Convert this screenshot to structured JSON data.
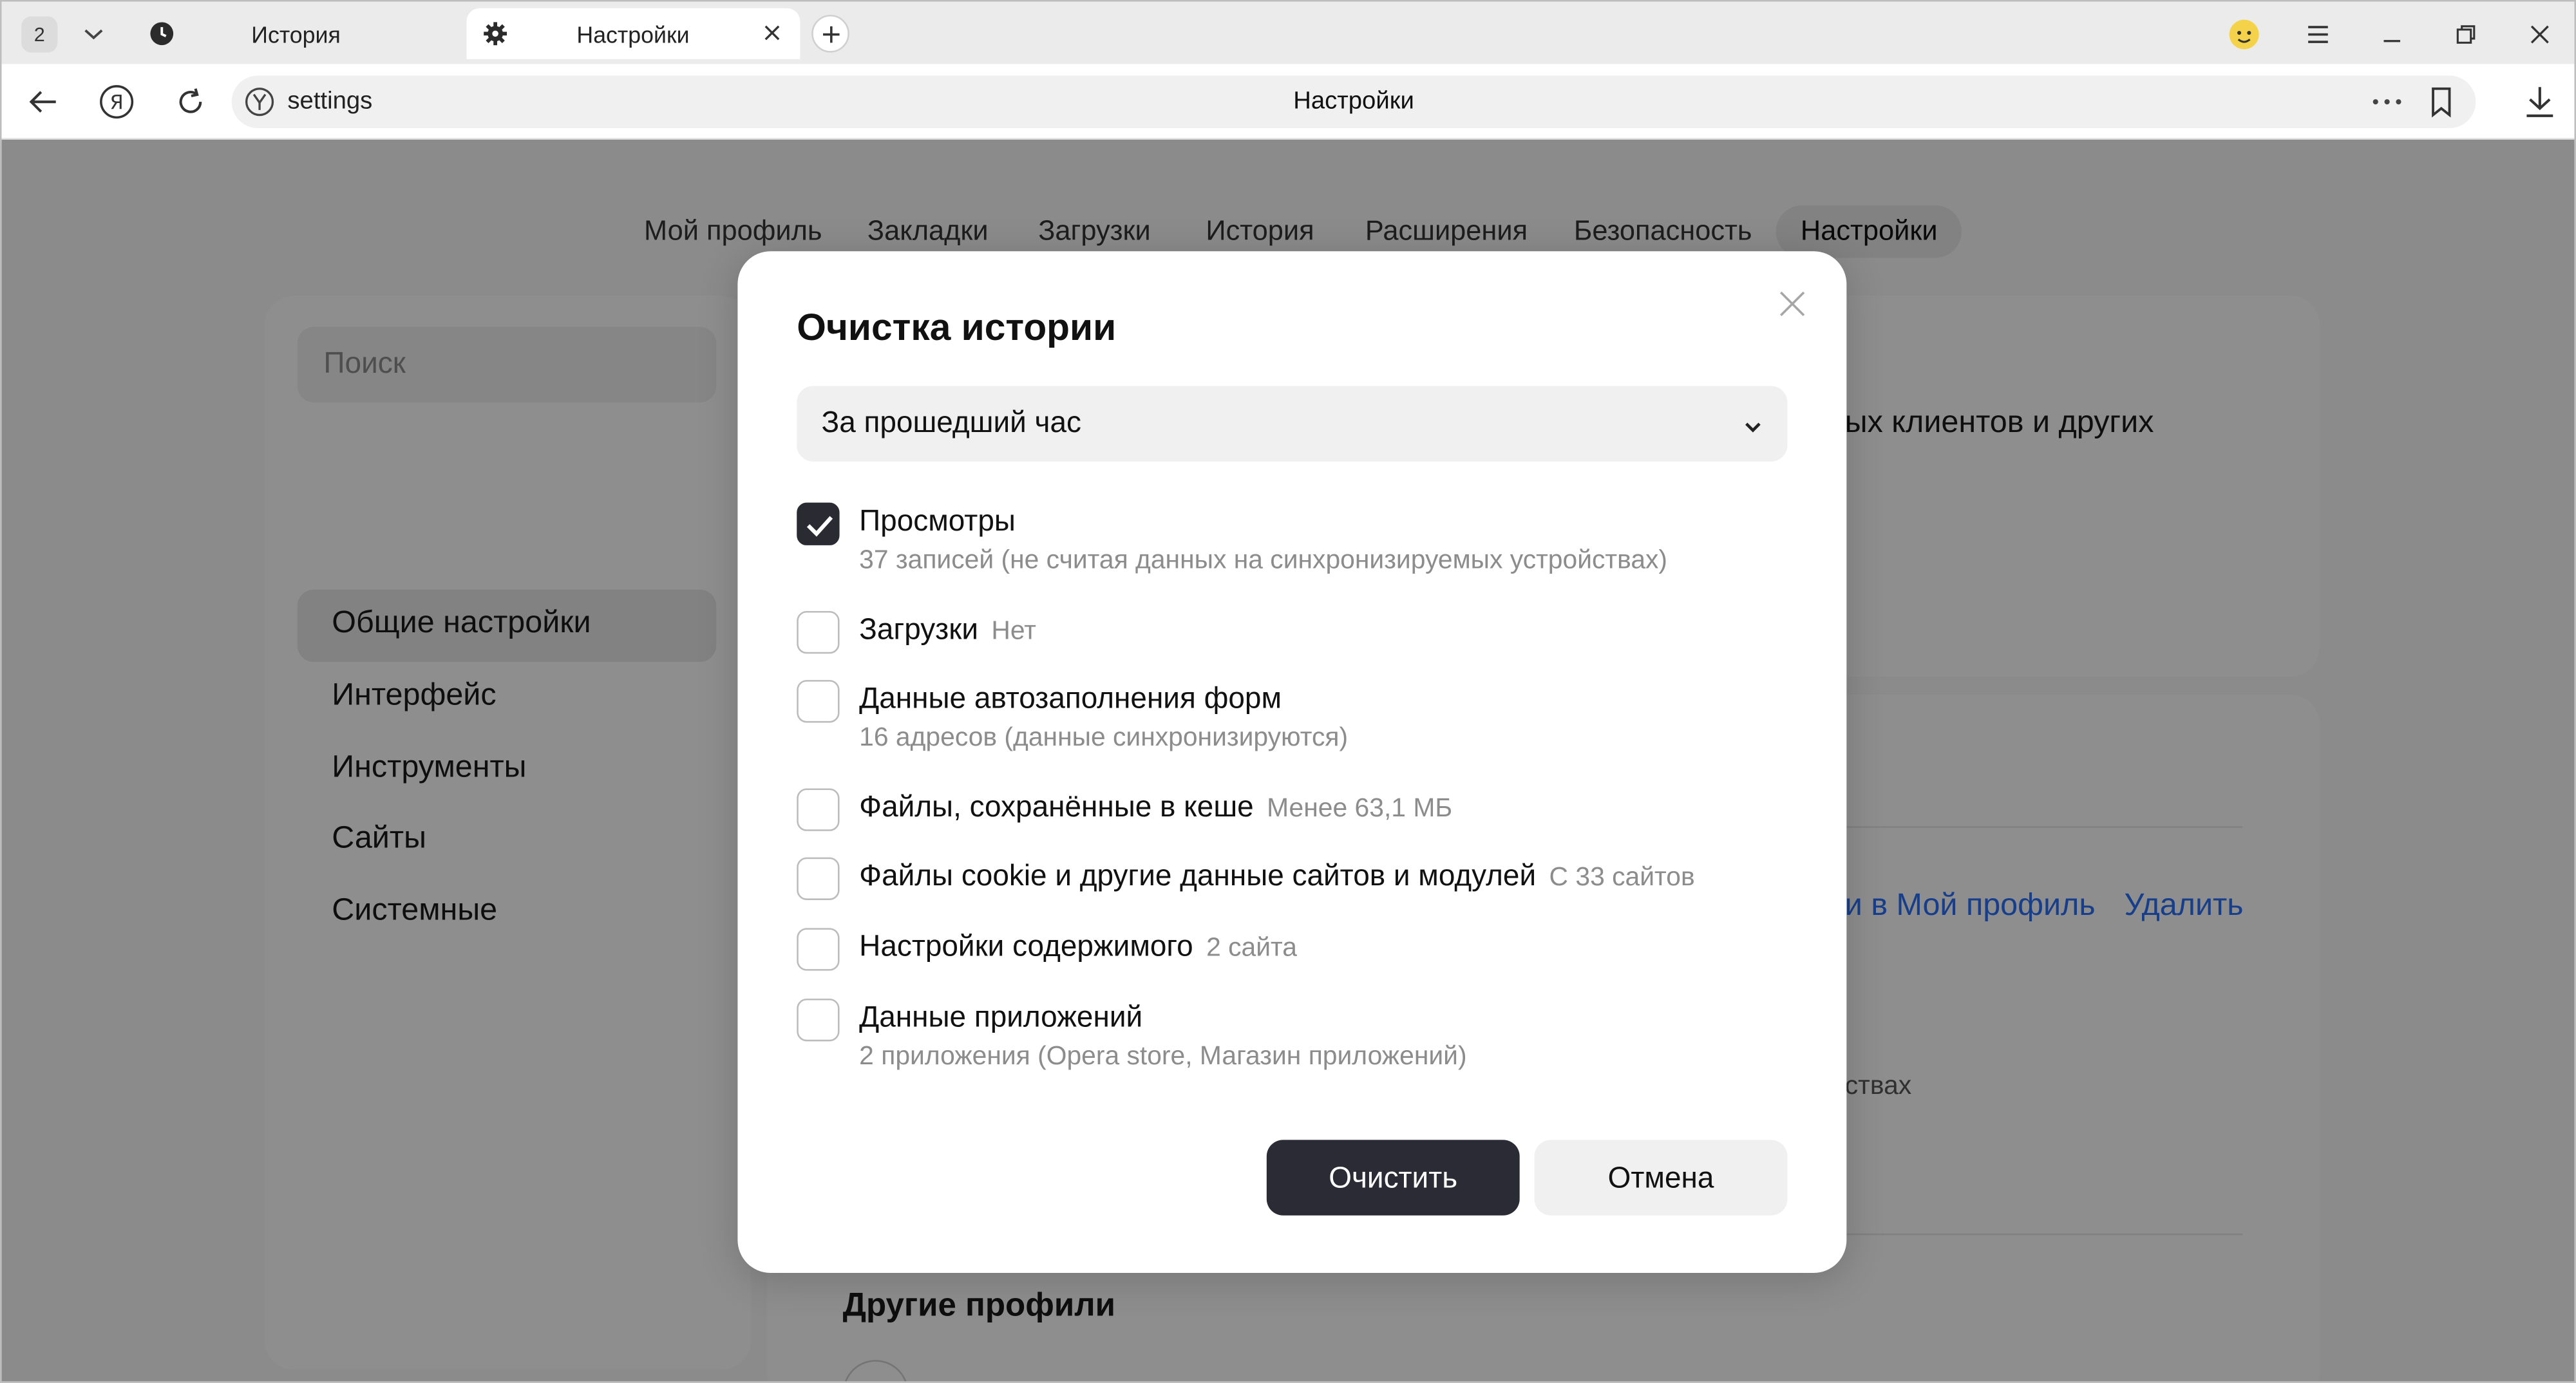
{
  "tabstrip": {
    "tab_count": "2",
    "tabs": [
      {
        "title": "История",
        "icon": "clock-icon"
      },
      {
        "title": "Настройки",
        "icon": "gear-icon"
      }
    ]
  },
  "toolbar": {
    "url": "settings",
    "page_title": "Настройки"
  },
  "nav": {
    "items": [
      "Мой профиль",
      "Закладки",
      "Загрузки",
      "История",
      "Расширения",
      "Безопасность",
      "Настройки"
    ],
    "active": "Настройки"
  },
  "sidebar": {
    "search_placeholder": "Поиск",
    "items": [
      "Общие настройки",
      "Интерфейс",
      "Инструменты",
      "Сайты",
      "Системные"
    ],
    "active": "Общие настройки"
  },
  "background": {
    "card1_text": "ых клиентов и других",
    "card2_link1": "и в Мой профиль",
    "card2_link2": "Удалить",
    "card2_text": "ствах",
    "other_profiles_title": "Другие профили"
  },
  "dialog": {
    "title": "Очистка истории",
    "period": "За прошедший час",
    "options": [
      {
        "label": "Просмотры",
        "note": "",
        "sub": "37 записей (не считая данных на синхронизируемых устройствах)",
        "checked": true
      },
      {
        "label": "Загрузки",
        "note": "Нет",
        "sub": "",
        "checked": false
      },
      {
        "label": "Данные автозаполнения форм",
        "note": "",
        "sub": "16 адресов (данные синхронизируются)",
        "checked": false
      },
      {
        "label": "Файлы, сохранённые в кеше",
        "note": "Менее 63,1 МБ",
        "sub": "",
        "checked": false
      },
      {
        "label": "Файлы cookie и другие данные сайтов и модулей",
        "note": "С 33 сайтов",
        "sub": "",
        "checked": false
      },
      {
        "label": "Настройки содержимого",
        "note": "2 сайта",
        "sub": "",
        "checked": false
      },
      {
        "label": "Данные приложений",
        "note": "",
        "sub": "2 приложения (Opera store, Магазин приложений)",
        "checked": false
      }
    ],
    "clear_button": "Очистить",
    "cancel_button": "Отмена"
  },
  "colors": {
    "accent_link": "#2a6df4",
    "primary_button": "#2b2b35",
    "overlay": "rgba(0,0,0,0.43)"
  }
}
